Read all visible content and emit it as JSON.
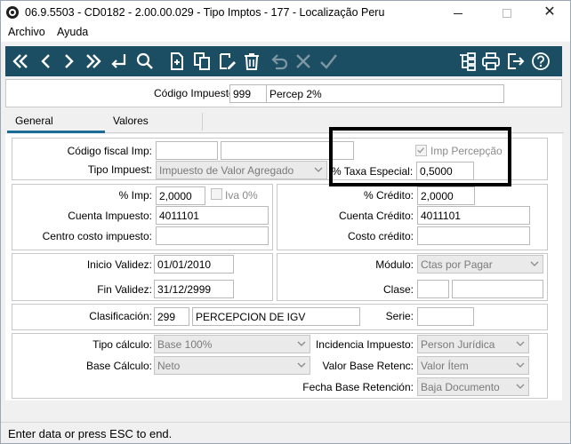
{
  "window": {
    "title": "06.9.5503 - CD0182 - 2.00.00.029 - Tipo Imptos - 177 - Localização Peru",
    "close_glyph": "✕"
  },
  "menu": {
    "items": [
      "Archivo",
      "Ayuda"
    ]
  },
  "toolbar": {
    "icons": [
      "first-record",
      "previous-record",
      "next-record",
      "last-record",
      "go-to",
      "search",
      "new-document",
      "copy",
      "edit",
      "delete",
      "undo",
      "cancel",
      "confirm",
      "tree-view",
      "print",
      "exit",
      "help"
    ]
  },
  "header": {
    "codigo_label": "Código Impuesto:",
    "codigo_value": "999",
    "desc_value": "Percep 2%"
  },
  "tabs": [
    "General",
    "Valores"
  ],
  "form": {
    "codigo_fiscal_label": "Código fiscal Imp:",
    "codigo_fiscal_value": "",
    "codigo_fiscal_desc": "",
    "tipo_impuest_label": "Tipo Impuest:",
    "tipo_impuest_value": "Impuesto de Valor Agregado",
    "imp_percepcion_label": "Imp Percepção",
    "imp_percepcion_checked": true,
    "taxa_especial_label": "% Taxa Especial:",
    "taxa_especial_value": "0,5000",
    "pct_imp_label": "% Imp:",
    "pct_imp_value": "2,0000",
    "iva_label": "Iva 0%",
    "cuenta_impuesto_label": "Cuenta Impuesto:",
    "cuenta_impuesto_value": "4011101",
    "centro_costo_label": "Centro costo impuesto:",
    "centro_costo_value": "",
    "pct_credito_label": "% Crédito:",
    "pct_credito_value": "2,0000",
    "cuenta_credito_label": "Cuenta Crédito:",
    "cuenta_credito_value": "4011101",
    "costo_credito_label": "Costo crédito:",
    "costo_credito_value": "",
    "inicio_validez_label": "Inicio Validez:",
    "inicio_validez_value": "01/01/2010",
    "fin_validez_label": "Fin Validez:",
    "fin_validez_value": "31/12/2999",
    "modulo_label": "Módulo:",
    "modulo_value": "Ctas por Pagar",
    "clase_label": "Clase:",
    "clase_value": "",
    "clase_desc": "",
    "clasificacion_label": "Clasificación:",
    "clasificacion_value": "299",
    "clasificacion_desc": "PERCEPCION DE IGV",
    "serie_label": "Serie:",
    "serie_value": "",
    "tipo_calculo_label": "Tipo cálculo:",
    "tipo_calculo_value": "Base 100%",
    "base_calculo_label": "Base Cálculo:",
    "base_calculo_value": "Neto",
    "incidencia_label": "Incidencia Impuesto:",
    "incidencia_value": "Person Jurídica",
    "valor_base_label": "Valor Base Retenc:",
    "valor_base_value": "Valor Ítem",
    "fecha_base_label": "Fecha Base Retención:",
    "fecha_base_value": "Baja Documento"
  },
  "status": {
    "text": "Enter data or press ESC to end."
  },
  "colors": {
    "toolbar_bg": "#1c4e63",
    "tab_accent": "#1a6b95",
    "highlight_border": "#000000"
  }
}
